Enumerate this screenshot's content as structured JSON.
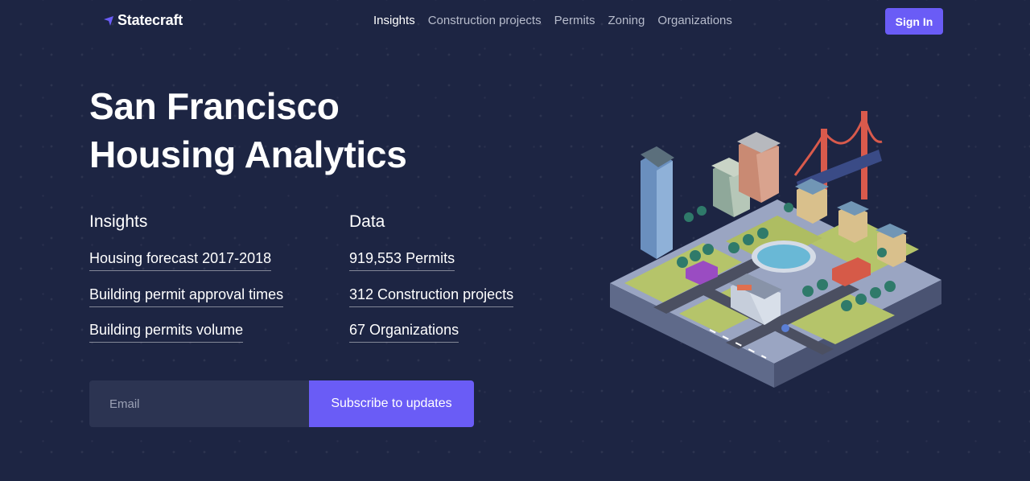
{
  "brand": {
    "name": "Statecraft",
    "accent": "#6a5cf6",
    "background": "#1d2543"
  },
  "nav": {
    "items": [
      {
        "label": "Insights",
        "active": true
      },
      {
        "label": "Construction projects",
        "active": false
      },
      {
        "label": "Permits",
        "active": false
      },
      {
        "label": "Zoning",
        "active": false
      },
      {
        "label": "Organizations",
        "active": false
      }
    ],
    "signin_label": "Sign In"
  },
  "hero": {
    "title_line1": "San Francisco",
    "title_line2": "Housing Analytics"
  },
  "insights": {
    "heading": "Insights",
    "links": [
      "Housing forecast 2017-2018",
      "Building permit approval times",
      "Building permits volume"
    ]
  },
  "data": {
    "heading": "Data",
    "links": [
      "919,553 Permits",
      "312 Construction projects",
      "67 Organizations"
    ]
  },
  "subscribe": {
    "placeholder": "Email",
    "button_label": "Subscribe to updates"
  }
}
